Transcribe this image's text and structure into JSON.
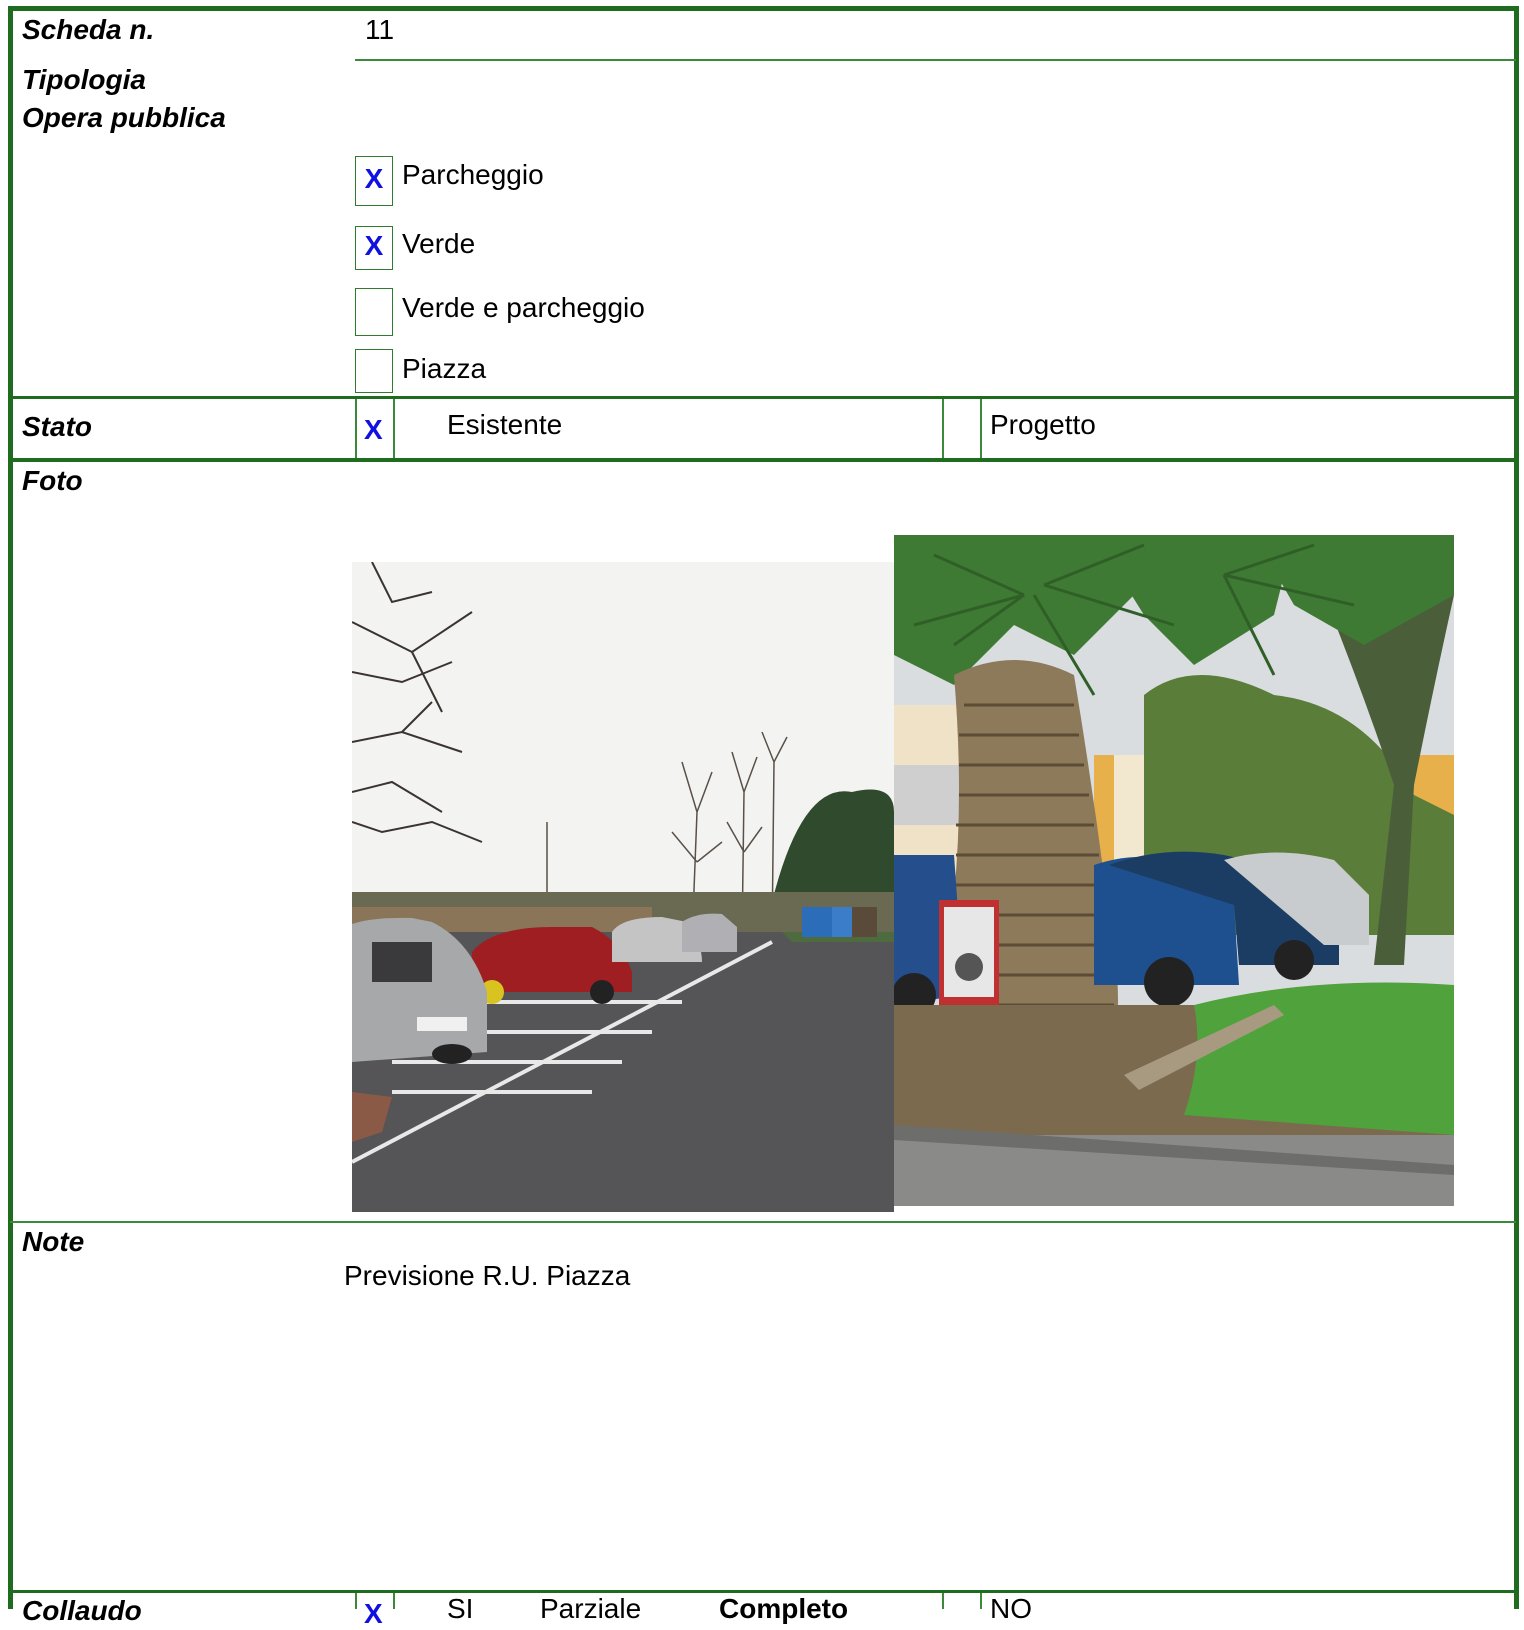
{
  "scheda": {
    "label": "Scheda n.",
    "value": "11"
  },
  "tipologia": {
    "label_line1": "Tipologia",
    "label_line2": "Opera pubblica",
    "options": [
      {
        "label": "Parcheggio",
        "mark": "X"
      },
      {
        "label": "Verde",
        "mark": "X"
      },
      {
        "label": "Verde e parcheggio",
        "mark": ""
      },
      {
        "label": "Piazza",
        "mark": ""
      }
    ]
  },
  "stato": {
    "label": "Stato",
    "mark": "X",
    "existing": "Esistente",
    "project": "Progetto"
  },
  "foto": {
    "label": "Foto"
  },
  "note": {
    "label": "Note",
    "text": "Previsione R.U. Piazza"
  },
  "collaudo": {
    "label": "Collaudo",
    "mark": "X",
    "si": "SI",
    "parziale": "Parziale",
    "completo": "Completo",
    "no": "NO"
  },
  "colors": {
    "border": "#1f6b1f",
    "check": "#1010e0"
  }
}
